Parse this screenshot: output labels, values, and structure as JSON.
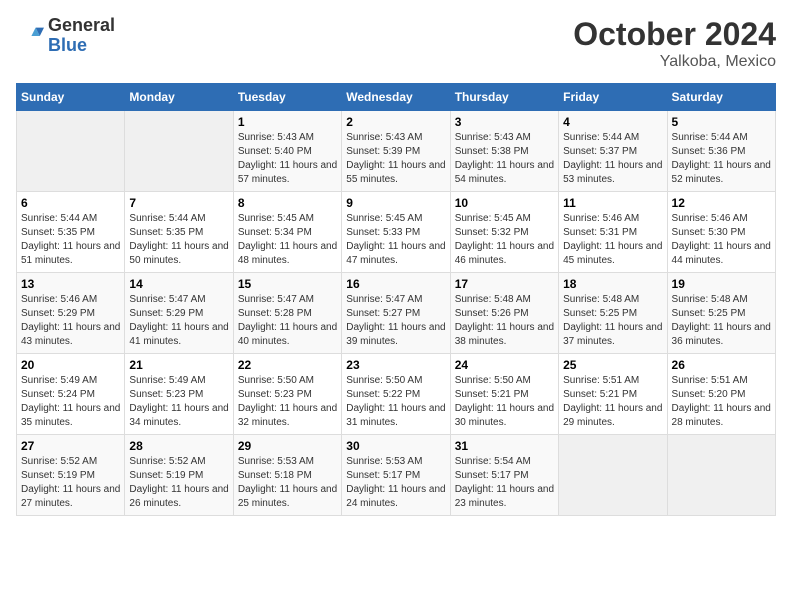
{
  "header": {
    "logo": {
      "general": "General",
      "blue": "Blue"
    },
    "title": "October 2024",
    "subtitle": "Yalkoba, Mexico"
  },
  "weekdays": [
    "Sunday",
    "Monday",
    "Tuesday",
    "Wednesday",
    "Thursday",
    "Friday",
    "Saturday"
  ],
  "weeks": [
    [
      {
        "day": "",
        "empty": true
      },
      {
        "day": "",
        "empty": true
      },
      {
        "day": "1",
        "sunrise": "5:43 AM",
        "sunset": "5:40 PM",
        "daylight": "11 hours and 57 minutes."
      },
      {
        "day": "2",
        "sunrise": "5:43 AM",
        "sunset": "5:39 PM",
        "daylight": "11 hours and 55 minutes."
      },
      {
        "day": "3",
        "sunrise": "5:43 AM",
        "sunset": "5:38 PM",
        "daylight": "11 hours and 54 minutes."
      },
      {
        "day": "4",
        "sunrise": "5:44 AM",
        "sunset": "5:37 PM",
        "daylight": "11 hours and 53 minutes."
      },
      {
        "day": "5",
        "sunrise": "5:44 AM",
        "sunset": "5:36 PM",
        "daylight": "11 hours and 52 minutes."
      }
    ],
    [
      {
        "day": "6",
        "sunrise": "5:44 AM",
        "sunset": "5:35 PM",
        "daylight": "11 hours and 51 minutes."
      },
      {
        "day": "7",
        "sunrise": "5:44 AM",
        "sunset": "5:35 PM",
        "daylight": "11 hours and 50 minutes."
      },
      {
        "day": "8",
        "sunrise": "5:45 AM",
        "sunset": "5:34 PM",
        "daylight": "11 hours and 48 minutes."
      },
      {
        "day": "9",
        "sunrise": "5:45 AM",
        "sunset": "5:33 PM",
        "daylight": "11 hours and 47 minutes."
      },
      {
        "day": "10",
        "sunrise": "5:45 AM",
        "sunset": "5:32 PM",
        "daylight": "11 hours and 46 minutes."
      },
      {
        "day": "11",
        "sunrise": "5:46 AM",
        "sunset": "5:31 PM",
        "daylight": "11 hours and 45 minutes."
      },
      {
        "day": "12",
        "sunrise": "5:46 AM",
        "sunset": "5:30 PM",
        "daylight": "11 hours and 44 minutes."
      }
    ],
    [
      {
        "day": "13",
        "sunrise": "5:46 AM",
        "sunset": "5:29 PM",
        "daylight": "11 hours and 43 minutes."
      },
      {
        "day": "14",
        "sunrise": "5:47 AM",
        "sunset": "5:29 PM",
        "daylight": "11 hours and 41 minutes."
      },
      {
        "day": "15",
        "sunrise": "5:47 AM",
        "sunset": "5:28 PM",
        "daylight": "11 hours and 40 minutes."
      },
      {
        "day": "16",
        "sunrise": "5:47 AM",
        "sunset": "5:27 PM",
        "daylight": "11 hours and 39 minutes."
      },
      {
        "day": "17",
        "sunrise": "5:48 AM",
        "sunset": "5:26 PM",
        "daylight": "11 hours and 38 minutes."
      },
      {
        "day": "18",
        "sunrise": "5:48 AM",
        "sunset": "5:25 PM",
        "daylight": "11 hours and 37 minutes."
      },
      {
        "day": "19",
        "sunrise": "5:48 AM",
        "sunset": "5:25 PM",
        "daylight": "11 hours and 36 minutes."
      }
    ],
    [
      {
        "day": "20",
        "sunrise": "5:49 AM",
        "sunset": "5:24 PM",
        "daylight": "11 hours and 35 minutes."
      },
      {
        "day": "21",
        "sunrise": "5:49 AM",
        "sunset": "5:23 PM",
        "daylight": "11 hours and 34 minutes."
      },
      {
        "day": "22",
        "sunrise": "5:50 AM",
        "sunset": "5:23 PM",
        "daylight": "11 hours and 32 minutes."
      },
      {
        "day": "23",
        "sunrise": "5:50 AM",
        "sunset": "5:22 PM",
        "daylight": "11 hours and 31 minutes."
      },
      {
        "day": "24",
        "sunrise": "5:50 AM",
        "sunset": "5:21 PM",
        "daylight": "11 hours and 30 minutes."
      },
      {
        "day": "25",
        "sunrise": "5:51 AM",
        "sunset": "5:21 PM",
        "daylight": "11 hours and 29 minutes."
      },
      {
        "day": "26",
        "sunrise": "5:51 AM",
        "sunset": "5:20 PM",
        "daylight": "11 hours and 28 minutes."
      }
    ],
    [
      {
        "day": "27",
        "sunrise": "5:52 AM",
        "sunset": "5:19 PM",
        "daylight": "11 hours and 27 minutes."
      },
      {
        "day": "28",
        "sunrise": "5:52 AM",
        "sunset": "5:19 PM",
        "daylight": "11 hours and 26 minutes."
      },
      {
        "day": "29",
        "sunrise": "5:53 AM",
        "sunset": "5:18 PM",
        "daylight": "11 hours and 25 minutes."
      },
      {
        "day": "30",
        "sunrise": "5:53 AM",
        "sunset": "5:17 PM",
        "daylight": "11 hours and 24 minutes."
      },
      {
        "day": "31",
        "sunrise": "5:54 AM",
        "sunset": "5:17 PM",
        "daylight": "11 hours and 23 minutes."
      },
      {
        "day": "",
        "empty": true
      },
      {
        "day": "",
        "empty": true
      }
    ]
  ],
  "labels": {
    "sunrise_prefix": "Sunrise: ",
    "sunset_prefix": "Sunset: ",
    "daylight_prefix": "Daylight: "
  }
}
